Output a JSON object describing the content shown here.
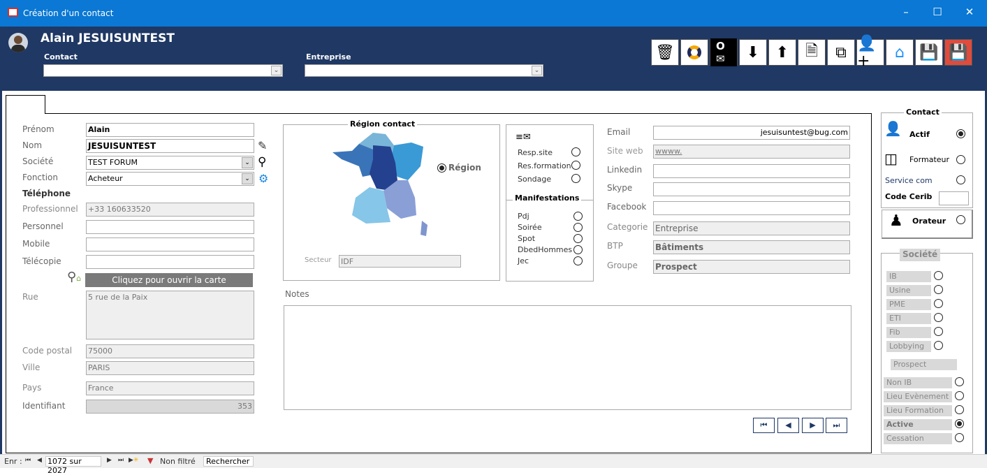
{
  "window": {
    "title": "Création d'un contact",
    "icon": "form-icon",
    "controls": [
      "minimize",
      "maximize",
      "close"
    ]
  },
  "header": {
    "name": "Alain JESUISUNTEST",
    "contact_label": "Contact",
    "contact_value": "",
    "entreprise_label": "Entreprise",
    "entreprise_value": "",
    "toolbar": [
      {
        "name": "delete",
        "icon": "trash-icon"
      },
      {
        "name": "refresh",
        "icon": "refresh-icon"
      },
      {
        "name": "outlook",
        "icon": "outlook-icon"
      },
      {
        "name": "download",
        "icon": "download-icon"
      },
      {
        "name": "upload",
        "icon": "upload-icon"
      },
      {
        "name": "new-document",
        "icon": "document-add-icon"
      },
      {
        "name": "copy",
        "icon": "copy-icon"
      },
      {
        "name": "add-user",
        "icon": "user-add-icon"
      },
      {
        "name": "home",
        "icon": "home-icon"
      },
      {
        "name": "save",
        "icon": "save-icon"
      },
      {
        "name": "save-close",
        "icon": "save-red-icon"
      }
    ]
  },
  "form": {
    "prenom_label": "Prénom",
    "prenom": "Alain",
    "nom_label": "Nom",
    "nom": "JESUISUNTEST",
    "societe_label": "Société",
    "societe": "TEST FORUM",
    "fonction_label": "Fonction",
    "fonction": "Acheteur",
    "telephone_heading": "Téléphone",
    "professionnel_label": "Professionnel",
    "professionnel": "+33 160633520",
    "personnel_label": "Personnel",
    "personnel": "",
    "mobile_label": "Mobile",
    "mobile": "",
    "telecopie_label": "Télécopie",
    "telecopie": "",
    "map_button": "Cliquez pour ouvrir la carte",
    "rue_label": "Rue",
    "rue": "5 rue de la Paix",
    "cp_label": "Code postal",
    "cp": "75000",
    "ville_label": "Ville",
    "ville": "PARIS",
    "pays_label": "Pays",
    "pays": "France",
    "identifiant_label": "Identifiant",
    "identifiant": "353"
  },
  "region": {
    "title": "Région contact",
    "region_option": "Région",
    "region_selected": true,
    "secteur_label": "Secteur",
    "secteur": "IDF"
  },
  "mailing": {
    "items": [
      {
        "label": "Resp.site",
        "on": false
      },
      {
        "label": "Res.formation",
        "on": false
      },
      {
        "label": "Sondage",
        "on": false
      }
    ],
    "manifestations_title": "Manifestations",
    "manifestations": [
      {
        "label": "Pdj",
        "on": false
      },
      {
        "label": "Soirée",
        "on": false
      },
      {
        "label": "Spot",
        "on": false
      },
      {
        "label": "DbedHommes",
        "on": false
      },
      {
        "label": "Jec",
        "on": false
      }
    ]
  },
  "web": {
    "email_label": "Email",
    "email": "jesuisuntest@bug.com",
    "site_label": "Site web",
    "site": "wwww.",
    "linkedin_label": "Linkedin",
    "linkedin": "",
    "skype_label": "Skype",
    "skype": "",
    "facebook_label": "Facebook",
    "facebook": "",
    "categorie_label": "Categorie",
    "categorie": "Entreprise",
    "btp_label": "BTP",
    "btp": "Bâtiments",
    "groupe_label": "Groupe",
    "groupe": "Prospect"
  },
  "notes": {
    "label": "Notes",
    "value": ""
  },
  "contact_panel": {
    "title": "Contact",
    "actif": "Actif",
    "actif_on": true,
    "formateur": "Formateur",
    "service_com": "Service com",
    "code_cerib_label": "Code Cerib",
    "code_cerib": "",
    "orateur": "Orateur"
  },
  "societe_panel": {
    "title": "Société",
    "items": [
      {
        "label": "IB",
        "on": false
      },
      {
        "label": "Usine",
        "on": false
      },
      {
        "label": "PME",
        "on": false
      },
      {
        "label": "ETI",
        "on": false
      },
      {
        "label": "Fib",
        "on": false
      },
      {
        "label": "Lobbying",
        "on": false
      }
    ],
    "prospect": "Prospect",
    "items2": [
      {
        "label": "Non IB",
        "on": false
      },
      {
        "label": "Lieu Evènement",
        "on": false
      },
      {
        "label": "Lieu Formation",
        "on": false
      },
      {
        "label": "Active",
        "on": true
      },
      {
        "label": "Cessation",
        "on": false
      }
    ]
  },
  "status": {
    "label": "Enr :",
    "record": "1072 sur 2027",
    "filter": "Non filtré",
    "search": "Rechercher"
  }
}
